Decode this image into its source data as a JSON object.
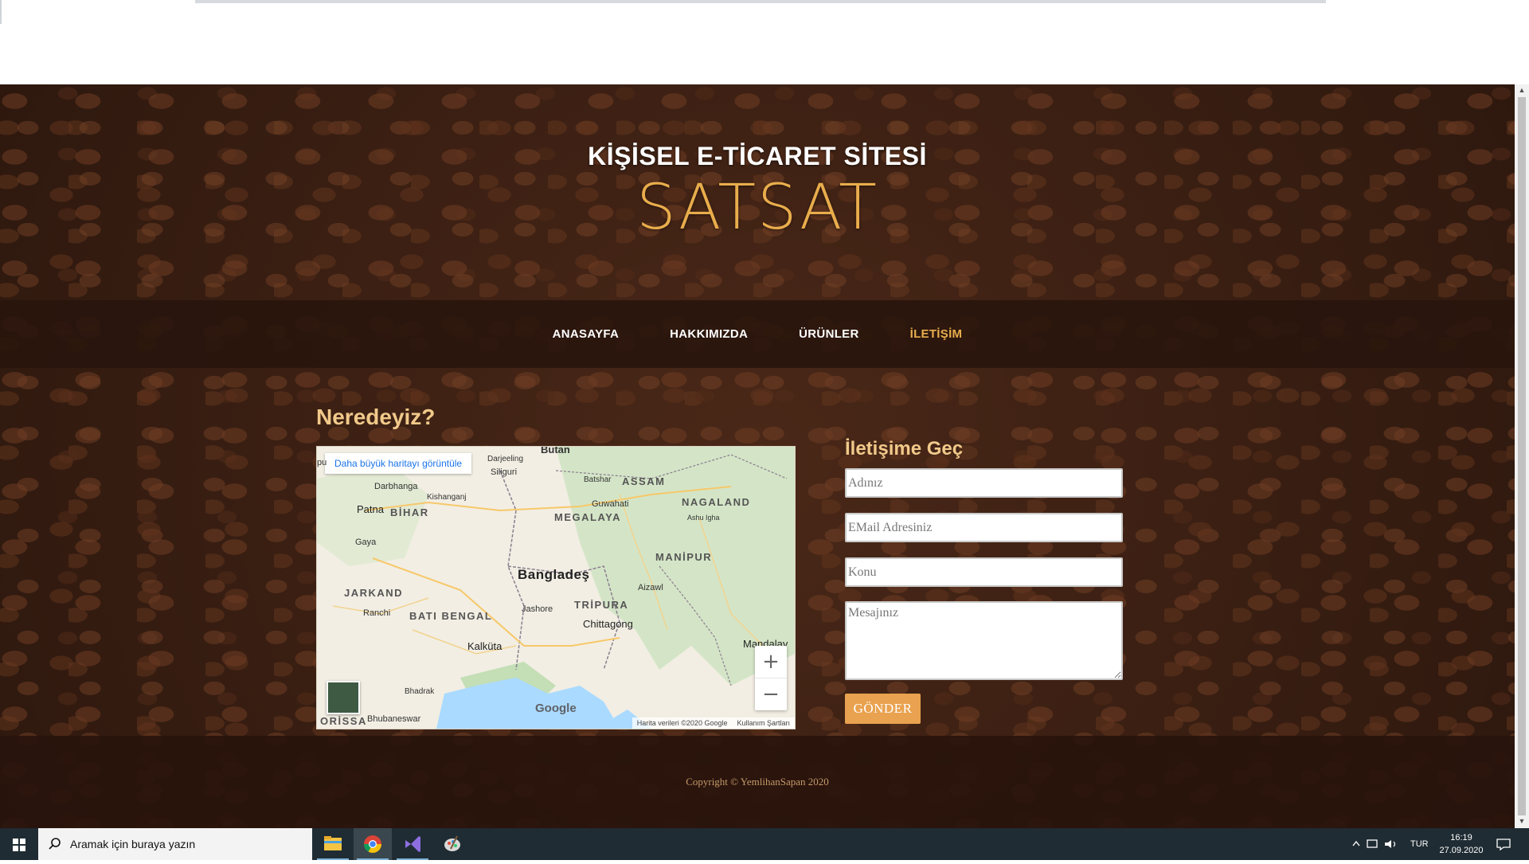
{
  "site": {
    "subtitle": "KİŞİSEL E-TİCARET SİTESİ",
    "title": "SATSAT"
  },
  "nav": {
    "items": [
      {
        "label": "ANASAYFA",
        "active": false
      },
      {
        "label": "HAKKIMIZDA",
        "active": false
      },
      {
        "label": "ÜRÜNLER",
        "active": false
      },
      {
        "label": "İLETİŞİM",
        "active": true
      }
    ]
  },
  "location": {
    "title": "Neredeyiz?",
    "map": {
      "larger_map_link": "Daha büyük haritayı görüntüle",
      "labels": {
        "bhutan": "Butan",
        "darjeeling": "Darjeeling",
        "siliguri": "Siliguri",
        "darbhanga": "Darbhanga",
        "kishanganj": "Kishanganj",
        "batshar": "Batshar",
        "assam": "ASSAM",
        "patna": "Patna",
        "bihar": "BİHAR",
        "guwahati": "Guwahati",
        "meghalaya": "MEGALAYA",
        "nagaland": "NAGALAND",
        "ashu_igha": "Ashu Igha",
        "gaya": "Gaya",
        "bangladesh": "Bangladeş",
        "manipur": "MANİPUR",
        "aizawl": "Aizawl",
        "jarkand": "JARKAND",
        "ranchi": "Ranchi",
        "bati_bengal": "BATI BENGAL",
        "jashore": "Jashore",
        "tripura": "TRİPURA",
        "chittagong": "Chittagong",
        "kalkuta": "Kalküta",
        "mandalay": "Mandalay",
        "bhadrak": "Bhadrak",
        "orissa": "ORİSSA",
        "bhubaneswar": "Bhubaneswar",
        "edge_left": "pu"
      },
      "google": "Google",
      "footer": {
        "data": "Harita verileri ©2020 Google",
        "terms": "Kullanım Şartları"
      },
      "zoom_in": "+",
      "zoom_out": "−"
    }
  },
  "contact": {
    "title": "İletişime Geç",
    "name_placeholder": "Adınız",
    "email_placeholder": "EMail Adresiniz",
    "subject_placeholder": "Konu",
    "message_placeholder": "Mesajınız",
    "submit": "GÖNDER"
  },
  "footer": {
    "copyright": "Copyright © YemlihanSapan 2020"
  },
  "taskbar": {
    "search_placeholder": "Aramak için buraya yazın",
    "language": "TUR",
    "time": "16:19",
    "date": "27.09.2020",
    "apps": [
      "file-explorer-icon",
      "chrome-icon",
      "visual-studio-icon",
      "paint-icon"
    ]
  },
  "colors": {
    "accent": "#e9ad4c",
    "heading": "#f1c98a",
    "button": "#e9a24f",
    "taskbar": "#1f2c33"
  }
}
